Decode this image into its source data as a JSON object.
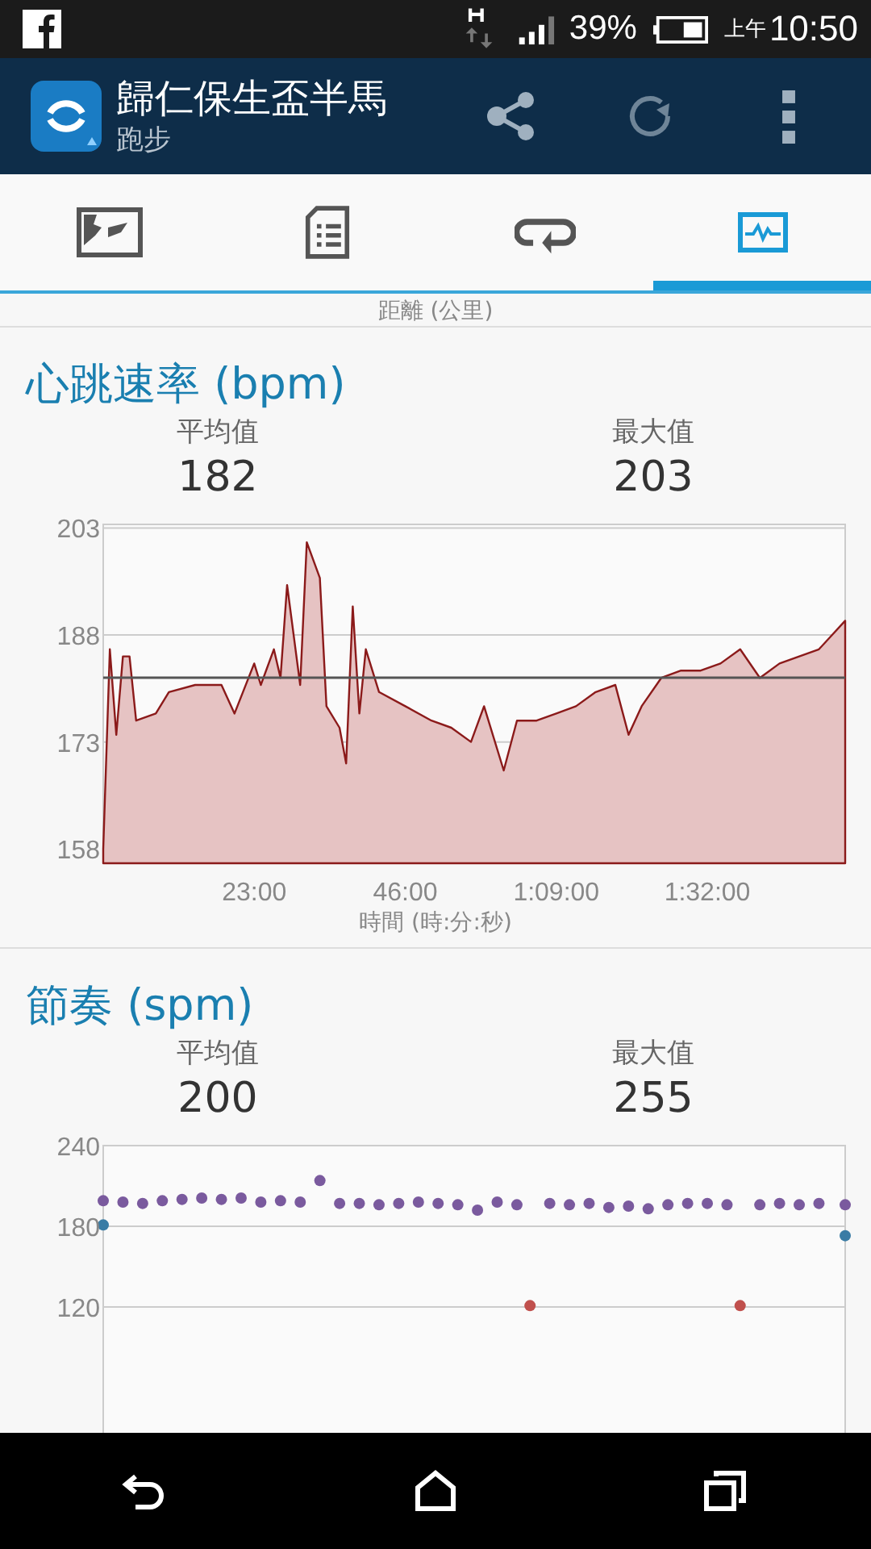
{
  "status_bar": {
    "battery": "39%",
    "am_pm": "上午",
    "time": "10:50"
  },
  "app_bar": {
    "title": "歸仁保生盃半馬",
    "subtitle": "跑步"
  },
  "tabs": [
    {
      "kind": "map",
      "selected": false
    },
    {
      "kind": "list",
      "selected": false
    },
    {
      "kind": "loop",
      "selected": false
    },
    {
      "kind": "chart",
      "selected": true
    }
  ],
  "prev_axis_label": "距離 (公里)",
  "sections": [
    {
      "title": "心跳速率 (bpm)",
      "stats": [
        {
          "label": "平均值",
          "value": "182"
        },
        {
          "label": "最大值",
          "value": "203"
        }
      ],
      "chart_data": {
        "type": "area",
        "xlabel": "時間 (時:分:秒)",
        "x": [
          0,
          1,
          2,
          3,
          4,
          5,
          8,
          10,
          14,
          18,
          20,
          23,
          24,
          26,
          27,
          28,
          30,
          31,
          33,
          34,
          36,
          37,
          38,
          39,
          40,
          42,
          46,
          50,
          53,
          56,
          58,
          61,
          63,
          66,
          69,
          72,
          75,
          78,
          80,
          82,
          85,
          88,
          91,
          94,
          97,
          100,
          103,
          106,
          109,
          111,
          113
        ],
        "series": [
          {
            "color": "#8b1a1a",
            "values": [
              158,
              186,
              174,
              185,
              185,
              176,
              177,
              180,
              181,
              181,
              177,
              184,
              181,
              186,
              182,
              195,
              181,
              201,
              196,
              178,
              175,
              170,
              192,
              177,
              186,
              180,
              178,
              176,
              175,
              173,
              178,
              169,
              176,
              176,
              177,
              178,
              180,
              181,
              174,
              178,
              182,
              183,
              183,
              184,
              186,
              182,
              184,
              185,
              186,
              188,
              190
            ]
          }
        ],
        "xlim": [
          0,
          113
        ],
        "ylim": [
          156,
          203.5
        ],
        "yticks": [
          158,
          173,
          188,
          203
        ],
        "xticks": [
          {
            "value": 23,
            "label": "23:00"
          },
          {
            "value": 46,
            "label": "46:00"
          },
          {
            "value": 69,
            "label": "1:09:00"
          },
          {
            "value": 92,
            "label": "1:32:00"
          }
        ],
        "ref_lines": [
          {
            "axis": "y",
            "value": 182
          }
        ]
      }
    },
    {
      "title": "節奏 (spm)",
      "stats": [
        {
          "label": "平均值",
          "value": "200"
        },
        {
          "label": "最大值",
          "value": "255"
        }
      ],
      "chart_data": {
        "type": "scatter",
        "x": [
          0,
          3,
          6,
          9,
          12,
          15,
          18,
          21,
          24,
          27,
          30,
          33,
          36,
          39,
          42,
          45,
          48,
          51,
          54,
          57,
          60,
          63,
          65,
          68,
          71,
          74,
          77,
          80,
          83,
          86,
          89,
          92,
          95,
          97,
          100,
          103,
          106,
          109,
          113
        ],
        "series": [
          {
            "color": "#7a5a9e",
            "values": [
              199,
              198,
              197,
              199,
              200,
              201,
              200,
              201,
              198,
              199,
              198,
              214,
              197,
              197,
              196,
              197,
              198,
              197,
              196,
              192,
              198,
              196,
              null,
              197,
              196,
              197,
              194,
              195,
              193,
              196,
              197,
              197,
              196,
              null,
              196,
              197,
              196,
              197,
              196
            ]
          },
          {
            "color": "#c0504d",
            "values": [
              null,
              null,
              null,
              null,
              null,
              null,
              null,
              null,
              null,
              null,
              null,
              null,
              null,
              null,
              null,
              null,
              null,
              null,
              null,
              null,
              null,
              null,
              121,
              null,
              null,
              null,
              null,
              null,
              null,
              null,
              null,
              null,
              null,
              121,
              null,
              null,
              null,
              null,
              null
            ]
          },
          {
            "color": "#3a7ca5",
            "values": [
              181,
              null,
              null,
              null,
              null,
              null,
              null,
              null,
              null,
              null,
              null,
              null,
              null,
              null,
              null,
              null,
              null,
              null,
              null,
              null,
              null,
              null,
              null,
              null,
              null,
              null,
              null,
              null,
              null,
              null,
              null,
              null,
              null,
              null,
              null,
              null,
              null,
              null,
              173
            ]
          }
        ],
        "xlim": [
          0,
          113
        ],
        "ylim": [
          0,
          240
        ],
        "yticks": [
          120,
          180,
          240
        ]
      }
    }
  ]
}
